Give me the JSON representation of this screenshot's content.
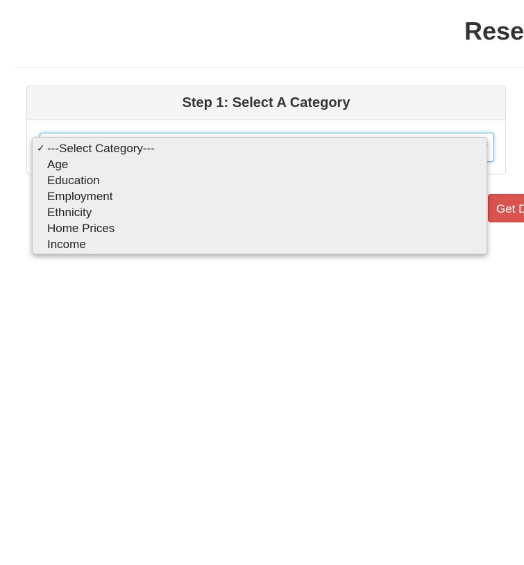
{
  "header": {
    "title": "Rese"
  },
  "panel": {
    "title": "Step 1: Select A Category"
  },
  "select": {
    "selected_value": "---Select Category---",
    "options": [
      "---Select Category---",
      "Age",
      "Education",
      "Employment",
      "Ethnicity",
      "Home Prices",
      "Income"
    ],
    "check_icon": "checkmark-icon"
  },
  "actions": {
    "get_data_label": "Get D"
  },
  "colors": {
    "button_danger": "#d9534f",
    "focus_border": "#66afe9",
    "panel_heading_bg": "#f5f5f5",
    "dropdown_bg": "#eeeeee"
  }
}
